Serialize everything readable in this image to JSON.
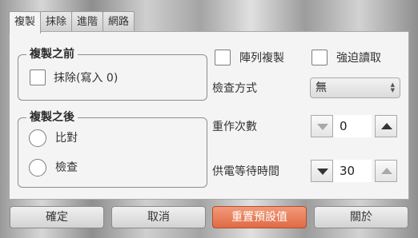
{
  "tabs": [
    "複製",
    "抹除",
    "進階",
    "網路"
  ],
  "copy_before": {
    "title": "複製之前",
    "erase_label": "抹除(寫入 0)",
    "erase_checked": false
  },
  "copy_after": {
    "title": "複製之後",
    "compare_label": "比對",
    "verify_label": "檢查",
    "selected": ""
  },
  "options": {
    "array_copy_label": "陣列複製",
    "array_copy_checked": false,
    "force_read_label": "強迫讀取",
    "force_read_checked": false
  },
  "check_method": {
    "label": "檢查方式",
    "value": "無"
  },
  "retry_count": {
    "label": "重作次數",
    "value": "0"
  },
  "power_wait": {
    "label": "供電等待時間",
    "value": "30"
  },
  "buttons": {
    "ok": "確定",
    "cancel": "取消",
    "reset": "重置預設值",
    "about": "關於"
  },
  "colors": {
    "accent": "#e47552",
    "panel": "#f4f4f4"
  }
}
